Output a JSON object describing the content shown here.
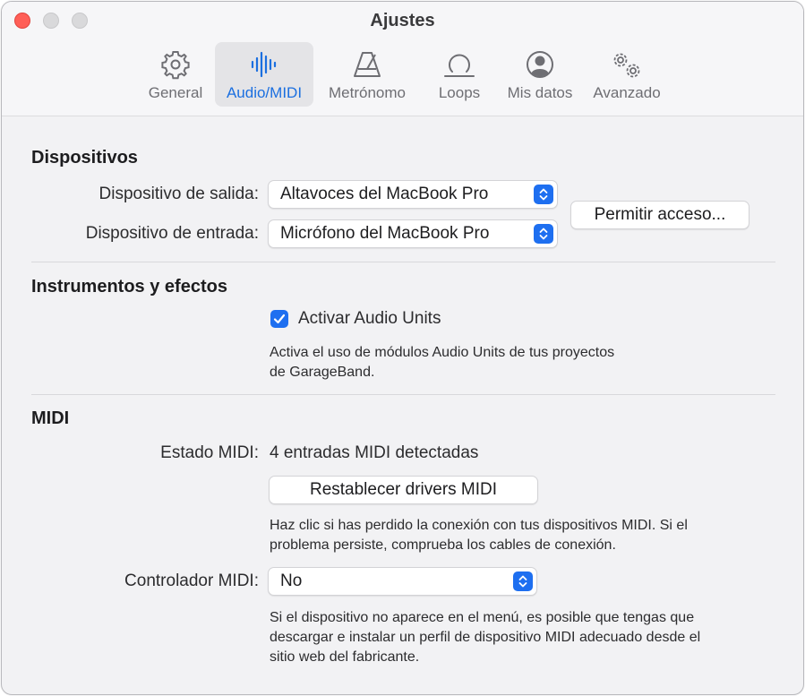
{
  "window": {
    "title": "Ajustes"
  },
  "tabs": [
    {
      "label": "General",
      "icon": "gear-icon"
    },
    {
      "label": "Audio/MIDI",
      "icon": "audio-waveform-icon",
      "active": true
    },
    {
      "label": "Metrónomo",
      "icon": "metronome-icon"
    },
    {
      "label": "Loops",
      "icon": "loop-icon"
    },
    {
      "label": "Mis datos",
      "icon": "person-circle-icon"
    },
    {
      "label": "Avanzado",
      "icon": "gears-icon"
    }
  ],
  "devices": {
    "title": "Dispositivos",
    "output_label": "Dispositivo de salida:",
    "output_value": "Altavoces del MacBook Pro",
    "input_label": "Dispositivo de entrada:",
    "input_value": "Micrófono del MacBook Pro",
    "access_button": "Permitir acceso..."
  },
  "instruments": {
    "title": "Instrumentos y efectos",
    "checkbox_label": "Activar Audio Units",
    "checked": true,
    "help_line1": "Activa el uso de módulos Audio Units de tus proyectos",
    "help_line2": "de GarageBand."
  },
  "midi": {
    "title": "MIDI",
    "status_label": "Estado MIDI:",
    "status_value": "4 entradas MIDI detectadas",
    "reset_button": "Restablecer drivers MIDI",
    "reset_help_line1": "Haz clic si has perdido la conexión con tus dispositivos MIDI. Si el",
    "reset_help_line2": "problema persiste, comprueba los cables de conexión.",
    "controller_label": "Controlador MIDI:",
    "controller_value": "No",
    "controller_help_line1": "Si el dispositivo no aparece en el menú, es posible que tengas que",
    "controller_help_line2": "descargar e instalar un perfil de dispositivo MIDI adecuado desde el",
    "controller_help_line3": "sitio web del fabricante."
  },
  "colors": {
    "accent": "#1e6ff0",
    "close": "#ff5f57"
  }
}
